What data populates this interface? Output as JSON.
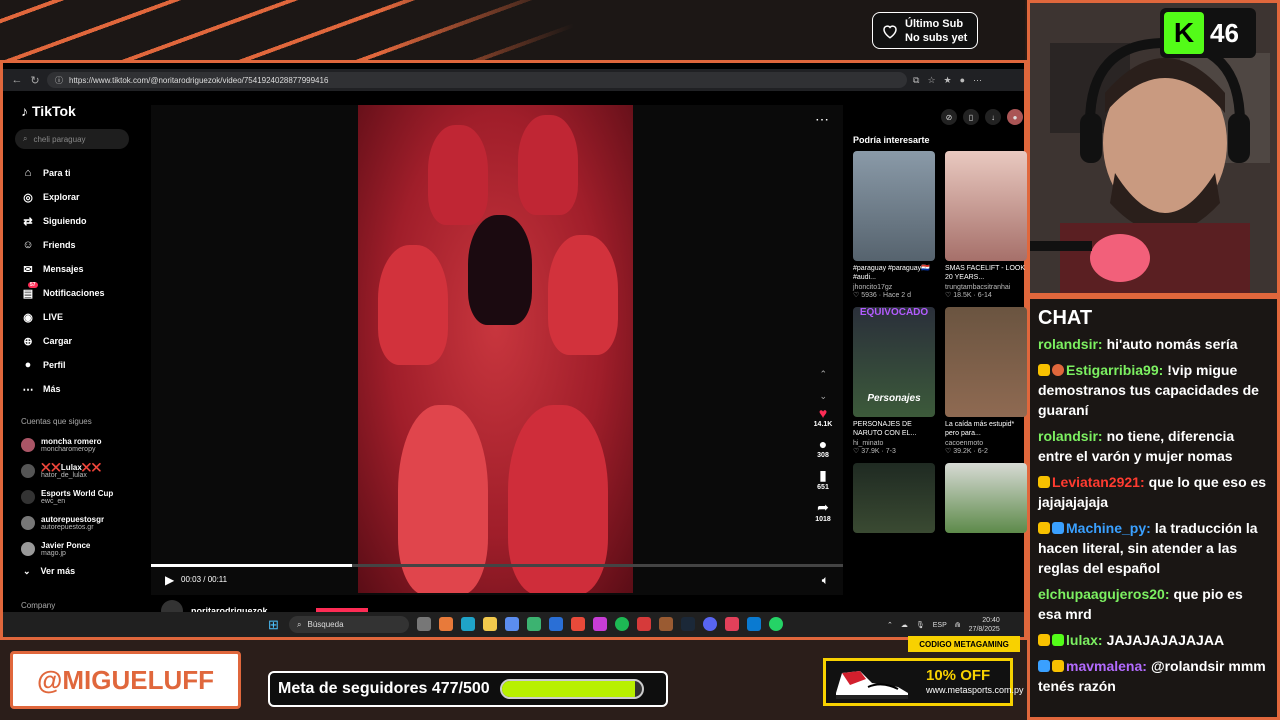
{
  "overlay": {
    "sub_title": "Último Sub",
    "sub_value": "No subs yet",
    "handle": "@MIGUELUFF",
    "goal_label": "Meta de seguidores 477/500",
    "goal_progress": 0.954,
    "kick_count": "46",
    "sponsor_code": "CODIGO METAGAMING",
    "sponsor_offer": "10% OFF",
    "sponsor_site": "www.metasports.com.py",
    "accent_color": "#e0673c"
  },
  "browser": {
    "url": "https://www.tiktok.com/@noritarodriguezok/video/7541924028877999416"
  },
  "tiktok": {
    "logo": "TikTok",
    "search_placeholder": "cheli paraguay",
    "nav": [
      {
        "label": "Para ti",
        "icon": "home-icon"
      },
      {
        "label": "Explorar",
        "icon": "compass-icon"
      },
      {
        "label": "Siguiendo",
        "icon": "following-icon"
      },
      {
        "label": "Friends",
        "icon": "friends-icon"
      },
      {
        "label": "Mensajes",
        "icon": "messages-icon"
      },
      {
        "label": "Notificaciones",
        "icon": "bell-icon",
        "badge": "57"
      },
      {
        "label": "LIVE",
        "icon": "live-icon"
      },
      {
        "label": "Cargar",
        "icon": "upload-icon"
      },
      {
        "label": "Perfil",
        "icon": "profile-icon"
      },
      {
        "label": "Más",
        "icon": "more-icon"
      }
    ],
    "following_title": "Cuentas que sigues",
    "following": [
      {
        "name": "moncha romero",
        "user": "moncharomeropy"
      },
      {
        "name": "❌❌Lulax❌❌",
        "user": "hator_de_lulax"
      },
      {
        "name": "Esports World Cup",
        "user": "ewc_en"
      },
      {
        "name": "autorepuestosgr",
        "user": "autorepuestos.gr"
      },
      {
        "name": "Javier Ponce",
        "user": "mago.jp"
      }
    ],
    "see_more": "Ver más",
    "company": "Company",
    "video_time": "00:03 / 00:11",
    "video_progress": 0.29,
    "likes": "14.1K",
    "comments": "308",
    "saves": "651",
    "shares": "1018",
    "author": "noritarodriguezok",
    "recs_title": "Podría interesarte",
    "recs": [
      {
        "caption": "#paraguay #paraguay🇵🇾 #audi...",
        "user": "jhoncito17gz",
        "meta": "♡ 5936 · Hace 2 d"
      },
      {
        "caption": "SMAS FACELIFT - LOOK 20 YEARS...",
        "user": "trungtambacsitranhai",
        "meta": "♡ 18.5K · 6-14"
      },
      {
        "caption": "PERSONAJES DE NARUTO CON EL...",
        "user": "hi_minato",
        "meta": "♡ 37.9K · 7-3"
      },
      {
        "caption": "La caída más estupid* pero para...",
        "user": "cacoenmoto",
        "meta": "♡ 39.2K · 6-2"
      }
    ],
    "rec_thumb_texts": [
      "EQUIVOCADO",
      "Personajes"
    ]
  },
  "taskbar": {
    "search": "Búsqueda",
    "lang": "ESP",
    "time": "20:40",
    "date": "27/8/2025"
  },
  "chat": {
    "title": "CHAT",
    "messages": [
      {
        "user": "rolandsir:",
        "text": "hi'auto nomás sería",
        "color": "#7cf061"
      },
      {
        "user": "Estigarribia99:",
        "text": "!vip migue demostranos tus capacidades de guaraní",
        "color": "#7cf061"
      },
      {
        "user": "rolandsir:",
        "text": "no tiene, diferencia entre el varón y mujer nomas",
        "color": "#7cf061"
      },
      {
        "user": "Leviatan2921:",
        "text": "que lo que eso es jajajajajaja",
        "color": "#ff3b30"
      },
      {
        "user": "Machine_py:",
        "text": "la traducción la hacen literal, sin atender a las reglas del español",
        "color": "#3aa0ff"
      },
      {
        "user": "elchupaagujeros20:",
        "text": "que pio es esa mrd",
        "color": "#7cf061"
      },
      {
        "user": "lulax:",
        "text": "JAJAJAJAJAJAA",
        "color": "#7cf061"
      },
      {
        "user": "mavmalena:",
        "text": "@rolandsir mmm tenés razón",
        "color": "#b36bff"
      }
    ]
  }
}
